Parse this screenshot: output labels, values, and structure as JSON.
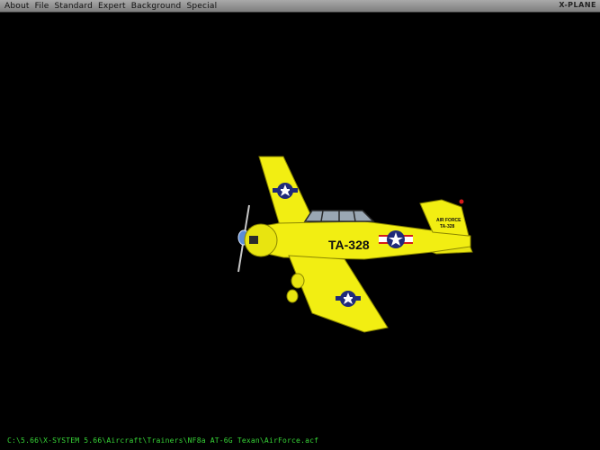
{
  "menubar": {
    "items": [
      {
        "label": "About"
      },
      {
        "label": "File"
      },
      {
        "label": "Standard"
      },
      {
        "label": "Expert"
      },
      {
        "label": "Background"
      },
      {
        "label": "Special"
      }
    ],
    "app_title": "X-PLANE"
  },
  "aircraft": {
    "tail_code": "TA-328",
    "fin_text_line1": "AIR FORCE",
    "fin_text_line2": "TA-328",
    "body_color": "#f2ee12",
    "insignia_color": "#1f2a7a",
    "accent_color": "#d41a1a"
  },
  "status": {
    "path": "C:\\5.66\\X-SYSTEM 5.66\\Aircraft\\Trainers\\NF8a AT-6G Texan\\AirForce.acf"
  }
}
